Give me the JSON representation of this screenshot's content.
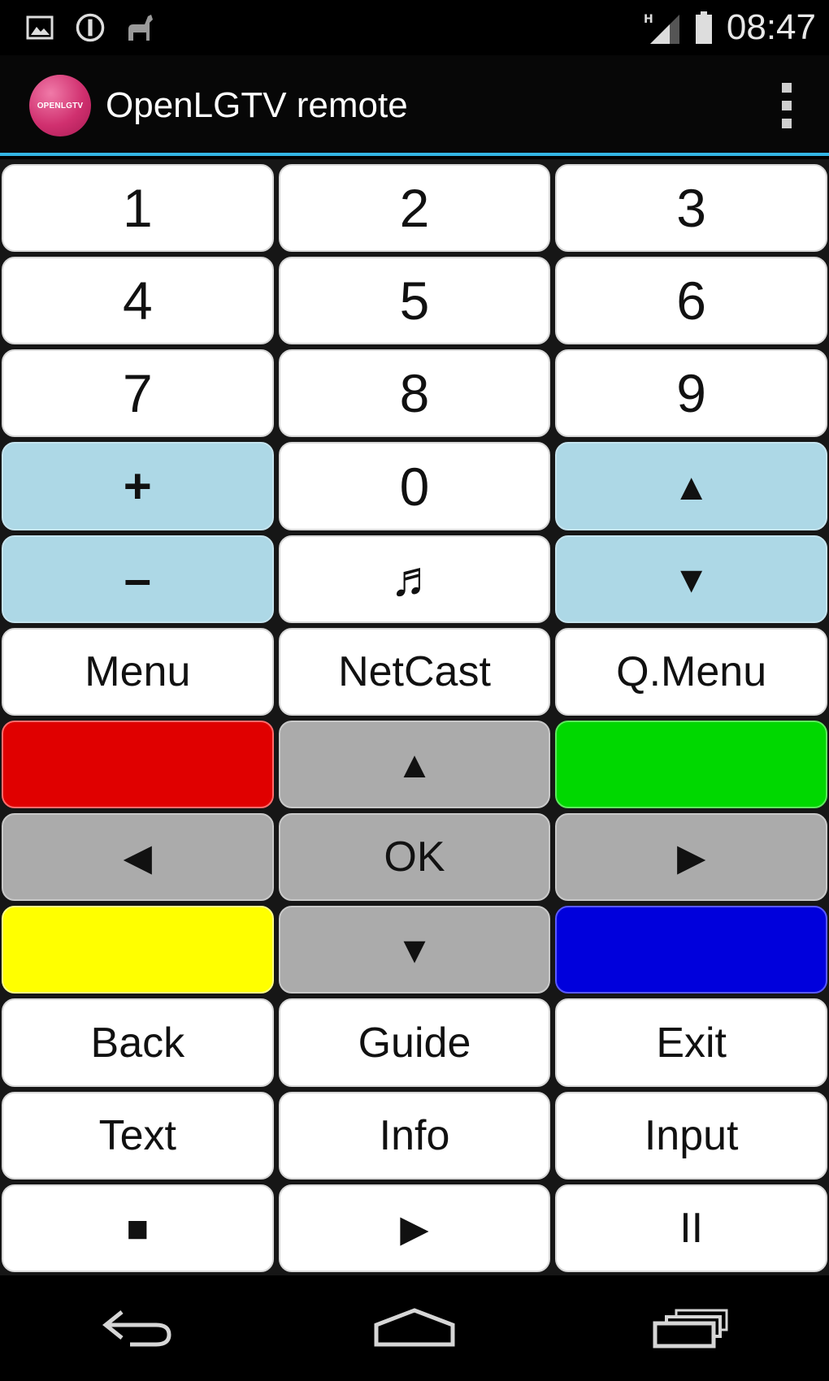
{
  "status_bar": {
    "time": "08:47",
    "icons": [
      "image-notification-icon",
      "sync-notification-icon",
      "android-notification-icon",
      "signal-h-icon",
      "battery-icon"
    ]
  },
  "action_bar": {
    "logo_text": "OPENLGTV",
    "title": "OpenLGTV remote",
    "overflow_icon": "overflow-menu-icon"
  },
  "buttons": {
    "n1": "1",
    "n2": "2",
    "n3": "3",
    "n4": "4",
    "n5": "5",
    "n6": "6",
    "n7": "7",
    "n8": "8",
    "n9": "9",
    "vol_up": "+",
    "n0": "0",
    "ch_up": "▲",
    "vol_down": "–",
    "mute": "♬",
    "ch_down": "▼",
    "menu": "Menu",
    "netcast": "NetCast",
    "qmenu": "Q.Menu",
    "nav_up": "▲",
    "nav_left": "◀",
    "ok": "OK",
    "nav_right": "▶",
    "nav_down": "▼",
    "back": "Back",
    "guide": "Guide",
    "exit": "Exit",
    "text": "Text",
    "info": "Info",
    "input": "Input",
    "stop": "■",
    "play": "▶",
    "pause": "II"
  },
  "colors": {
    "red": "#e00000",
    "green": "#00d800",
    "yellow": "#ffff00",
    "blue": "#0000dc",
    "accent": "#33b5e5",
    "light_blue": "#add8e6",
    "gray": "#ababab"
  },
  "nav_bar": {
    "icons": [
      "back-icon",
      "home-icon",
      "recent-apps-icon"
    ]
  }
}
